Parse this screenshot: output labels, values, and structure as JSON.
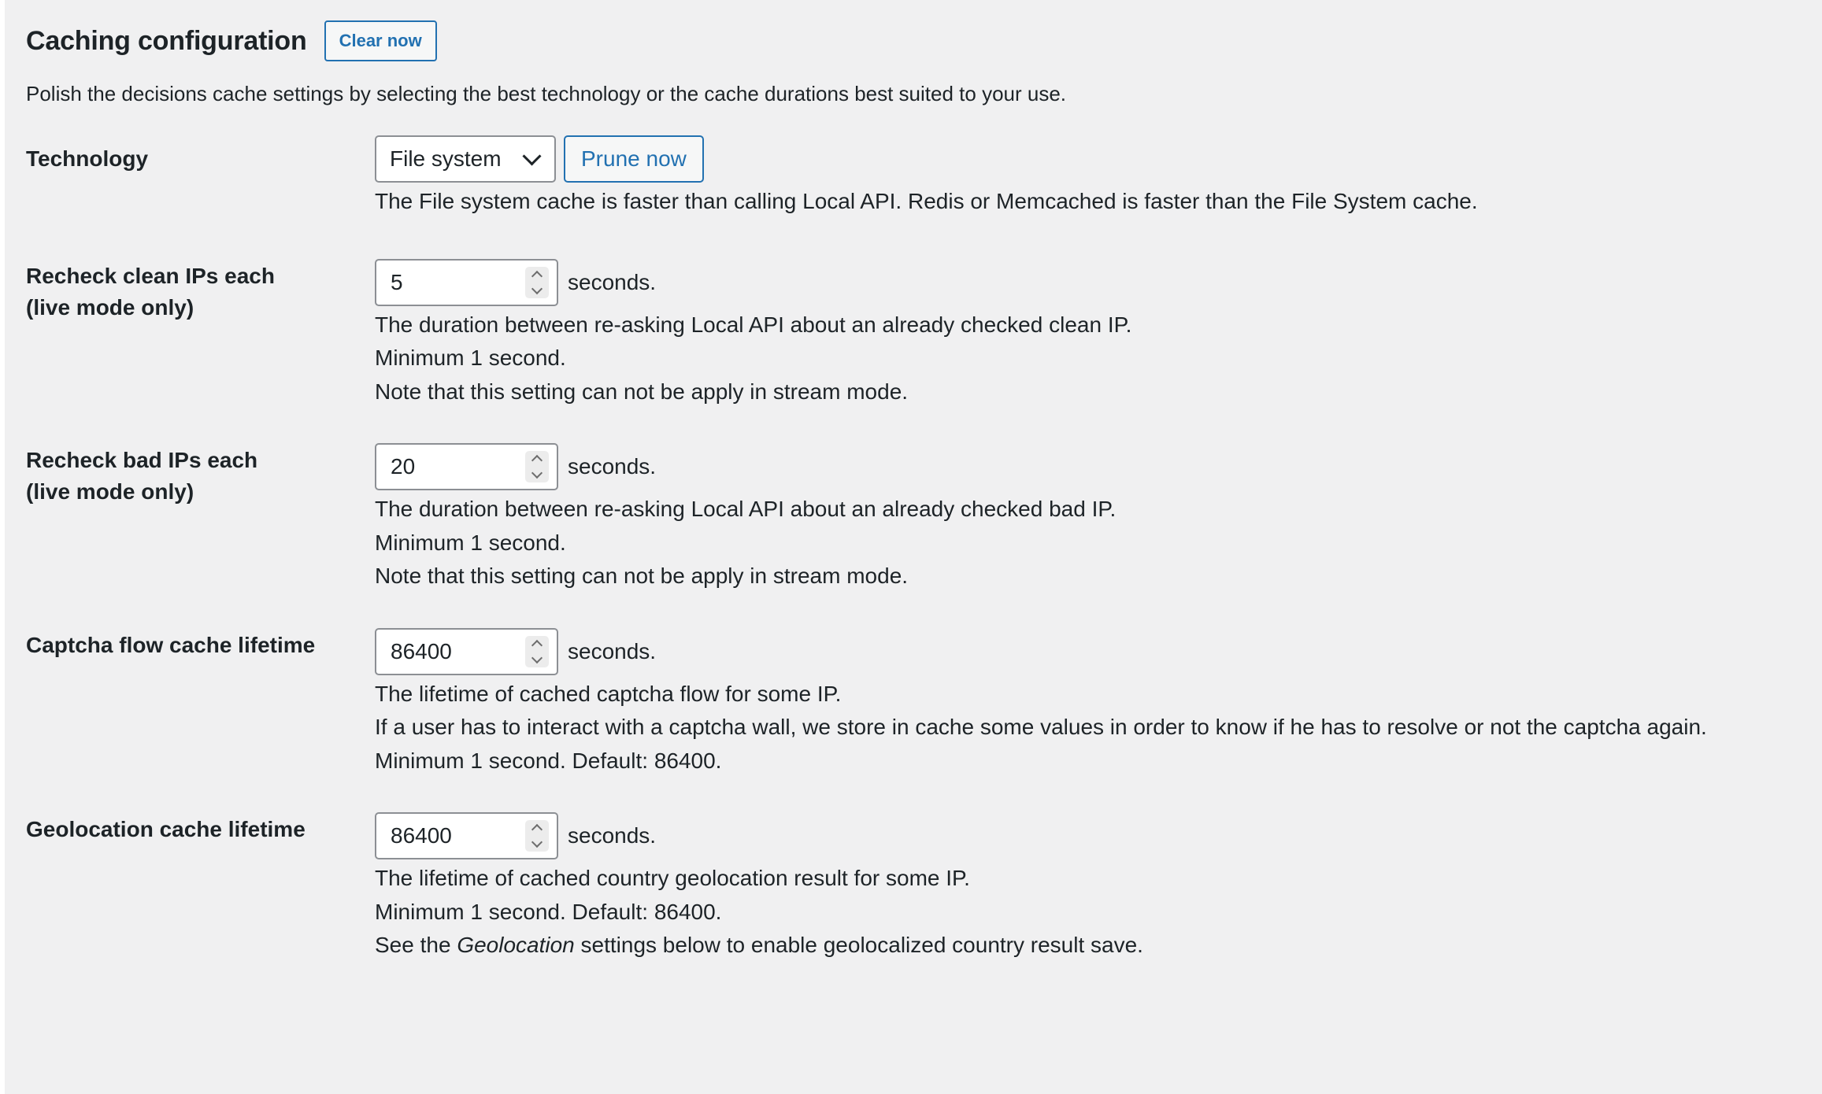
{
  "header": {
    "title": "Caching configuration",
    "clear_button": "Clear now",
    "description": "Polish the decisions cache settings by selecting the best technology or the cache durations best suited to your use."
  },
  "technology": {
    "label": "Technology",
    "selected": "File system",
    "prune_button": "Prune now",
    "help": "The File system cache is faster than calling Local API. Redis or Memcached is faster than the File System cache."
  },
  "recheck_clean": {
    "label_line1": "Recheck clean IPs each",
    "label_line2": "(live mode only)",
    "value": "5",
    "unit": "seconds.",
    "help1": "The duration between re-asking Local API about an already checked clean IP.",
    "help2": "Minimum 1 second.",
    "help3": "Note that this setting can not be apply in stream mode."
  },
  "recheck_bad": {
    "label_line1": "Recheck bad IPs each",
    "label_line2": "(live mode only)",
    "value": "20",
    "unit": "seconds.",
    "help1": "The duration between re-asking Local API about an already checked bad IP.",
    "help2": "Minimum 1 second.",
    "help3": "Note that this setting can not be apply in stream mode."
  },
  "captcha": {
    "label": "Captcha flow cache lifetime",
    "value": "86400",
    "unit": "seconds.",
    "help1": "The lifetime of cached captcha flow for some IP.",
    "help2": "If a user has to interact with a captcha wall, we store in cache some values in order to know if he has to resolve or not the captcha again.",
    "help3": "Minimum 1 second. Default: 86400."
  },
  "geolocation": {
    "label": "Geolocation cache lifetime",
    "value": "86400",
    "unit": "seconds.",
    "help1": "The lifetime of cached country geolocation result for some IP.",
    "help2": "Minimum 1 second. Default: 86400.",
    "help3_prefix": "See the ",
    "help3_em": "Geolocation",
    "help3_suffix": " settings below to enable geolocalized country result save."
  }
}
